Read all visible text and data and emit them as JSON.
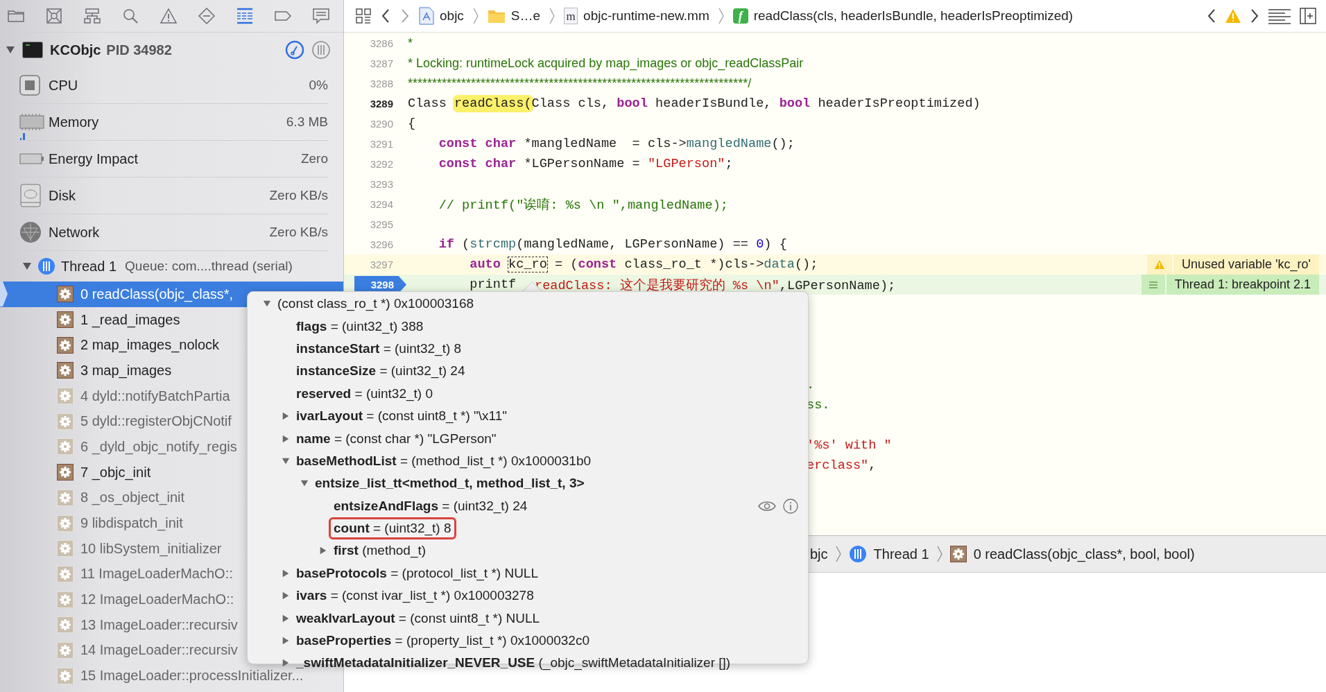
{
  "navigator_tabs": [
    {
      "selected": false
    },
    {
      "selected": false
    },
    {
      "selected": false
    },
    {
      "selected": false
    },
    {
      "selected": false
    },
    {
      "selected": false
    },
    {
      "selected": true
    },
    {
      "selected": false
    },
    {
      "selected": false
    }
  ],
  "process": {
    "name": "KCObjc",
    "pid": "PID 34982",
    "expanded": true
  },
  "gauges": [
    {
      "kind": "cpu",
      "label": "CPU",
      "value": "0%"
    },
    {
      "kind": "memory",
      "label": "Memory",
      "value": "6.3 MB"
    },
    {
      "kind": "energy",
      "label": "Energy Impact",
      "value": "Zero"
    },
    {
      "kind": "disk",
      "label": "Disk",
      "value": "Zero KB/s"
    },
    {
      "kind": "network",
      "label": "Network",
      "value": "Zero KB/s"
    }
  ],
  "thread": {
    "name": "Thread 1",
    "queue": "Queue: com....thread (serial)",
    "expanded": true
  },
  "frames": [
    {
      "label": "0 readClass(objc_class*,",
      "selected": true,
      "dimmed": false
    },
    {
      "label": "1 _read_images",
      "selected": false,
      "dimmed": false
    },
    {
      "label": "2 map_images_nolock",
      "selected": false,
      "dimmed": false
    },
    {
      "label": "3 map_images",
      "selected": false,
      "dimmed": false
    },
    {
      "label": "4 dyld::notifyBatchPartia",
      "selected": false,
      "dimmed": true
    },
    {
      "label": "5 dyld::registerObjCNotif",
      "selected": false,
      "dimmed": true
    },
    {
      "label": "6 _dyld_objc_notify_regis",
      "selected": false,
      "dimmed": true
    },
    {
      "label": "7 _objc_init",
      "selected": false,
      "dimmed": false
    },
    {
      "label": "8 _os_object_init",
      "selected": false,
      "dimmed": true
    },
    {
      "label": "9 libdispatch_init",
      "selected": false,
      "dimmed": true
    },
    {
      "label": "10 libSystem_initializer",
      "selected": false,
      "dimmed": true
    },
    {
      "label": "11 ImageLoaderMachO::",
      "selected": false,
      "dimmed": true
    },
    {
      "label": "12 ImageLoaderMachO::",
      "selected": false,
      "dimmed": true
    },
    {
      "label": "13 ImageLoader::recursiv",
      "selected": false,
      "dimmed": true
    },
    {
      "label": "14 ImageLoader::recursiv",
      "selected": false,
      "dimmed": true
    },
    {
      "label": "15 ImageLoader::processInitializer...",
      "selected": false,
      "dimmed": true
    }
  ],
  "jump_bar": {
    "crumbs": [
      {
        "kind": "project",
        "label": "objc"
      },
      {
        "kind": "folder",
        "label": "S…e"
      },
      {
        "kind": "file",
        "icon_letter": "m",
        "label": "objc-runtime-new.mm"
      },
      {
        "kind": "function",
        "icon_letter": "f",
        "label": "readClass(cls, headerIsBundle, headerIsPreoptimized)"
      }
    ]
  },
  "code_lines": [
    {
      "number": "3286",
      "kind": "plain",
      "spans": [
        {
          "kind": "doc",
          "text": "*"
        }
      ]
    },
    {
      "number": "3287",
      "kind": "plain",
      "spans": [
        {
          "kind": "doc",
          "text": "* Locking: runtimeLock acquired by map_images or objc_readClassPair"
        }
      ]
    },
    {
      "number": "3288",
      "kind": "plain",
      "spans": [
        {
          "kind": "doc",
          "text": "**********************************************************************/"
        }
      ]
    },
    {
      "number": "3289",
      "kind": "cursor",
      "spans": [
        {
          "kind": "plain",
          "text": "Class "
        },
        {
          "kind": "highlight",
          "text": "readClass("
        },
        {
          "kind": "plain",
          "text": "Class cls, "
        },
        {
          "kind": "keyword",
          "text": "bool"
        },
        {
          "kind": "plain",
          "text": " headerIsBundle, "
        },
        {
          "kind": "keyword",
          "text": "bool"
        },
        {
          "kind": "plain",
          "text": " headerIsPreoptimized)"
        }
      ]
    },
    {
      "number": "3290",
      "kind": "plain",
      "spans": [
        {
          "kind": "plain",
          "text": "{"
        }
      ]
    },
    {
      "number": "3291",
      "kind": "plain",
      "spans": [
        {
          "kind": "indent"
        },
        {
          "kind": "keyword",
          "text": "const char"
        },
        {
          "kind": "plain",
          "text": " *mangledName  = cls->"
        },
        {
          "kind": "method",
          "text": "mangledName"
        },
        {
          "kind": "plain",
          "text": "();"
        }
      ]
    },
    {
      "number": "3292",
      "kind": "plain",
      "spans": [
        {
          "kind": "indent"
        },
        {
          "kind": "keyword",
          "text": "const char"
        },
        {
          "kind": "plain",
          "text": " *LGPersonName = "
        },
        {
          "kind": "string",
          "text": "\"LGPerson\""
        },
        {
          "kind": "plain",
          "text": ";"
        }
      ]
    },
    {
      "number": "3293",
      "kind": "plain"
    },
    {
      "number": "3294",
      "kind": "plain",
      "spans": [
        {
          "kind": "indent"
        },
        {
          "kind": "comment",
          "text": "// printf(\"诶唷: %s \\n \",mangledName);"
        }
      ]
    },
    {
      "number": "3295",
      "kind": "plain"
    },
    {
      "number": "3296",
      "kind": "plain",
      "spans": [
        {
          "kind": "indent"
        },
        {
          "kind": "keyword",
          "text": "if"
        },
        {
          "kind": "plain",
          "text": " ("
        },
        {
          "kind": "method",
          "text": "strcmp"
        },
        {
          "kind": "plain",
          "text": "(mangledName, LGPersonName) == "
        },
        {
          "kind": "number",
          "text": "0"
        },
        {
          "kind": "plain",
          "text": ") {"
        }
      ]
    },
    {
      "number": "3297",
      "kind": "warning",
      "spans": [
        {
          "kind": "indent"
        },
        {
          "kind": "indent"
        },
        {
          "kind": "keyword",
          "text": "auto"
        },
        {
          "kind": "space"
        },
        {
          "kind": "dashed",
          "text": "kc_ro"
        },
        {
          "kind": "plain",
          "text": " = ("
        },
        {
          "kind": "keyword",
          "text": "const"
        },
        {
          "kind": "plain",
          "text": " class_ro_t *)cls->"
        },
        {
          "kind": "method",
          "text": "data"
        },
        {
          "kind": "plain",
          "text": "();"
        }
      ],
      "annotation": {
        "kind": "warning",
        "text": "Unused variable 'kc_ro'"
      }
    },
    {
      "number": "3298",
      "kind": "breakpoint",
      "spans": [
        {
          "kind": "indent"
        },
        {
          "kind": "indent"
        },
        {
          "kind": "plain",
          "text": "printf"
        },
        {
          "kind": "pointer"
        },
        {
          "kind": "string",
          "text": "readClass: 这个是我要研究的 %s \\n\""
        },
        {
          "kind": "plain",
          "text": ",LGPersonName);"
        }
      ],
      "annotation": {
        "kind": "breakpoint",
        "text": "Thread 1: breakpoint 2.1"
      }
    },
    {
      "kind": "covered"
    },
    {
      "kind": "covered"
    },
    {
      "kind": "covered"
    },
    {
      "kind": "covered"
    },
    {
      "kind": "covered",
      "spans": [
        {
          "kind": "comment",
          "text": "."
        }
      ]
    },
    {
      "kind": "covered",
      "spans": [
        {
          "kind": "comment",
          "text": "ss."
        }
      ]
    },
    {
      "kind": "covered"
    },
    {
      "kind": "covered",
      "spans": [
        {
          "kind": "string",
          "text": "'%s' with \""
        }
      ]
    },
    {
      "kind": "covered",
      "spans": [
        {
          "kind": "string",
          "text": "erclass\""
        },
        {
          "kind": "plain",
          "text": ","
        }
      ]
    }
  ],
  "popover": {
    "items": [
      {
        "text": "(const class_ro_t *) 0x100003168",
        "expanded": true,
        "highlighted": false,
        "children": [
          {
            "name": "flags",
            "text": "= (uint32_t) 388",
            "highlighted": false
          },
          {
            "name": "instanceStart",
            "text": "= (uint32_t) 8",
            "highlighted": false
          },
          {
            "name": "instanceSize",
            "text": "= (uint32_t) 24",
            "highlighted": false
          },
          {
            "name": "reserved",
            "text": "= (uint32_t) 0",
            "highlighted": false
          },
          {
            "name": "ivarLayout",
            "text": "= (const uint8_t *) \"\\x11\"",
            "expanded": false,
            "highlighted": false
          },
          {
            "name": "name",
            "text": "= (const char *) \"LGPerson\"",
            "expanded": false,
            "highlighted": false
          },
          {
            "name": "baseMethodList",
            "text": "= (method_list_t *) 0x1000031b0",
            "expanded": true,
            "highlighted": false,
            "children": [
              {
                "name": "entsize_list_tt<method_t, method_list_t, 3>",
                "expanded": true,
                "highlighted": false,
                "children": [
                  {
                    "name": "entsizeAndFlags",
                    "text": "= (uint32_t) 24",
                    "highlighted": false,
                    "hovered": true
                  },
                  {
                    "name": "count",
                    "text": "= (uint32_t) 8",
                    "highlighted": true
                  },
                  {
                    "name": "first",
                    "text": "(method_t)",
                    "expanded": false,
                    "highlighted": false
                  }
                ]
              }
            ]
          },
          {
            "name": "baseProtocols",
            "text": "= (protocol_list_t *) NULL",
            "expanded": false,
            "highlighted": false
          },
          {
            "name": "ivars",
            "text": "= (const ivar_list_t *) 0x100003278",
            "expanded": false,
            "highlighted": false
          },
          {
            "name": "weakIvarLayout",
            "text": "= (const uint8_t *) NULL",
            "expanded": false,
            "highlighted": false
          },
          {
            "name": "baseProperties",
            "text": "= (property_list_t *) 0x1000032c0",
            "expanded": false,
            "highlighted": false
          },
          {
            "name": "_swiftMetadataInitializer_NEVER_USE",
            "text": "(_objc_swiftMetadataInitializer [])",
            "expanded": false,
            "highlighted": false
          }
        ]
      }
    ]
  },
  "debug_bar": {
    "crumbs": [
      {
        "kind": "text",
        "label": "bjc"
      },
      {
        "kind": "thread",
        "label": "Thread 1"
      },
      {
        "kind": "frame",
        "label": "0 readClass(objc_class*, bool, bool)"
      }
    ]
  }
}
